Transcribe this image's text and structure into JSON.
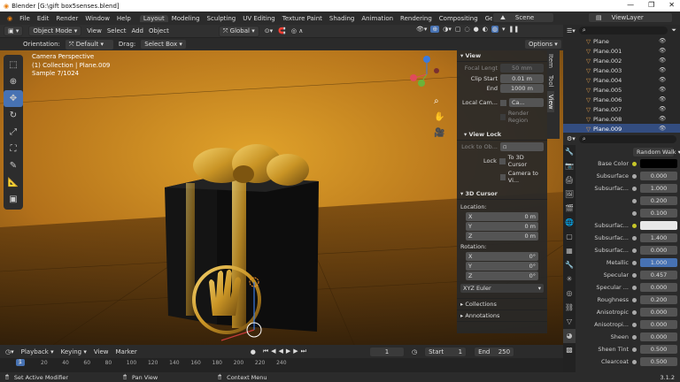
{
  "window": {
    "title": "Blender [G:\\gift box5senses.blend]",
    "min": "—",
    "max": "❐",
    "close": "✕"
  },
  "menu": {
    "items": [
      "File",
      "Edit",
      "Render",
      "Window",
      "Help"
    ],
    "workspaces": [
      "Layout",
      "Modeling",
      "Sculpting",
      "UV Editing",
      "Texture Paint",
      "Shading",
      "Animation",
      "Rendering",
      "Compositing",
      "Geometry Nod"
    ],
    "scene": "Scene",
    "viewlayer": "ViewLayer"
  },
  "header": {
    "mode": "Object Mode",
    "view": "View",
    "select": "Select",
    "add": "Add",
    "object": "Object",
    "transform": "Global",
    "options": "Options"
  },
  "toolhdr": {
    "orientation_label": "Orientation:",
    "orientation": "Default",
    "drag_label": "Drag:",
    "drag": "Select Box"
  },
  "viewport": {
    "line1": "Camera Perspective",
    "line2": "(1) Collection | Plane.009",
    "line3": "Sample 7/1024"
  },
  "npanel": {
    "tabs": [
      "Item",
      "Tool",
      "View"
    ],
    "view_title": "View",
    "focal_label": "Focal Lengt",
    "focal_value": "50 mm",
    "clip_start_label": "Clip Start",
    "clip_start": "0.01 m",
    "clip_end_label": "End",
    "clip_end": "1000 m",
    "local_cam_label": "Local Cam...",
    "local_cam_value": "Ca...",
    "render_region": "Render Region",
    "view_lock_title": "View Lock",
    "lock_obj_label": "Lock to Ob...",
    "lock_label": "Lock",
    "to_cursor": "To 3D Cursor",
    "cam_to_view": "Camera to Vi...",
    "cursor_title": "3D Cursor",
    "location_label": "Location:",
    "x": "X",
    "y": "Y",
    "z": "Z",
    "loc_x": "0 m",
    "loc_y": "0 m",
    "loc_z": "0 m",
    "rotation_label": "Rotation:",
    "rot_x": "0°",
    "rot_y": "0°",
    "rot_z": "0°",
    "rot_mode": "XYZ Euler",
    "collections": "Collections",
    "annotations": "Annotations"
  },
  "outliner": {
    "items": [
      "Plane",
      "Plane.001",
      "Plane.002",
      "Plane.003",
      "Plane.004",
      "Plane.005",
      "Plane.006",
      "Plane.007",
      "Plane.008",
      "Plane.009"
    ],
    "selected": "Plane.009"
  },
  "properties": {
    "subsurface_method": "Random Walk",
    "rows": [
      {
        "label": "Base Color",
        "value": "",
        "kind": "color",
        "color": "#000000"
      },
      {
        "label": "Subsurface",
        "value": "0.000",
        "kind": "num"
      },
      {
        "label": "Subsurfac...",
        "value": "1.000",
        "kind": "num"
      },
      {
        "label": "",
        "value": "0.200",
        "kind": "num"
      },
      {
        "label": "",
        "value": "0.100",
        "kind": "num"
      },
      {
        "label": "Subsurfac...",
        "value": "",
        "kind": "color",
        "color": "#e8e8e8"
      },
      {
        "label": "Subsurfac...",
        "value": "1.400",
        "kind": "num"
      },
      {
        "label": "Subsurfac...",
        "value": "0.000",
        "kind": "num"
      },
      {
        "label": "Metallic",
        "value": "1.000",
        "kind": "blue"
      },
      {
        "label": "Specular",
        "value": "0.457",
        "kind": "num"
      },
      {
        "label": "Specular ...",
        "value": "0.000",
        "kind": "num"
      },
      {
        "label": "Roughness",
        "value": "0.200",
        "kind": "num"
      },
      {
        "label": "Anisotropic",
        "value": "0.000",
        "kind": "num"
      },
      {
        "label": "Anisotropi...",
        "value": "0.000",
        "kind": "num"
      },
      {
        "label": "Sheen",
        "value": "0.000",
        "kind": "num"
      },
      {
        "label": "Sheen Tint",
        "value": "0.500",
        "kind": "num"
      },
      {
        "label": "Clearcoat",
        "value": "0.500",
        "kind": "num"
      }
    ],
    "version": "3.1.2"
  },
  "timeline": {
    "playback": "Playback",
    "keying": "Keying",
    "view": "View",
    "marker": "Marker",
    "current": "1",
    "start_label": "Start",
    "start": "1",
    "end_label": "End",
    "end": "250",
    "ticks": [
      "1",
      "20",
      "40",
      "60",
      "80",
      "100",
      "120",
      "140",
      "160",
      "180",
      "200",
      "220",
      "240"
    ]
  },
  "status": {
    "left": "Set Active Modifier",
    "middle": "Pan View",
    "right": "Context Menu"
  },
  "colors": {
    "accent": "#4772b3",
    "selected_row": "#334d80",
    "viewport_bg": "#b06c10"
  }
}
